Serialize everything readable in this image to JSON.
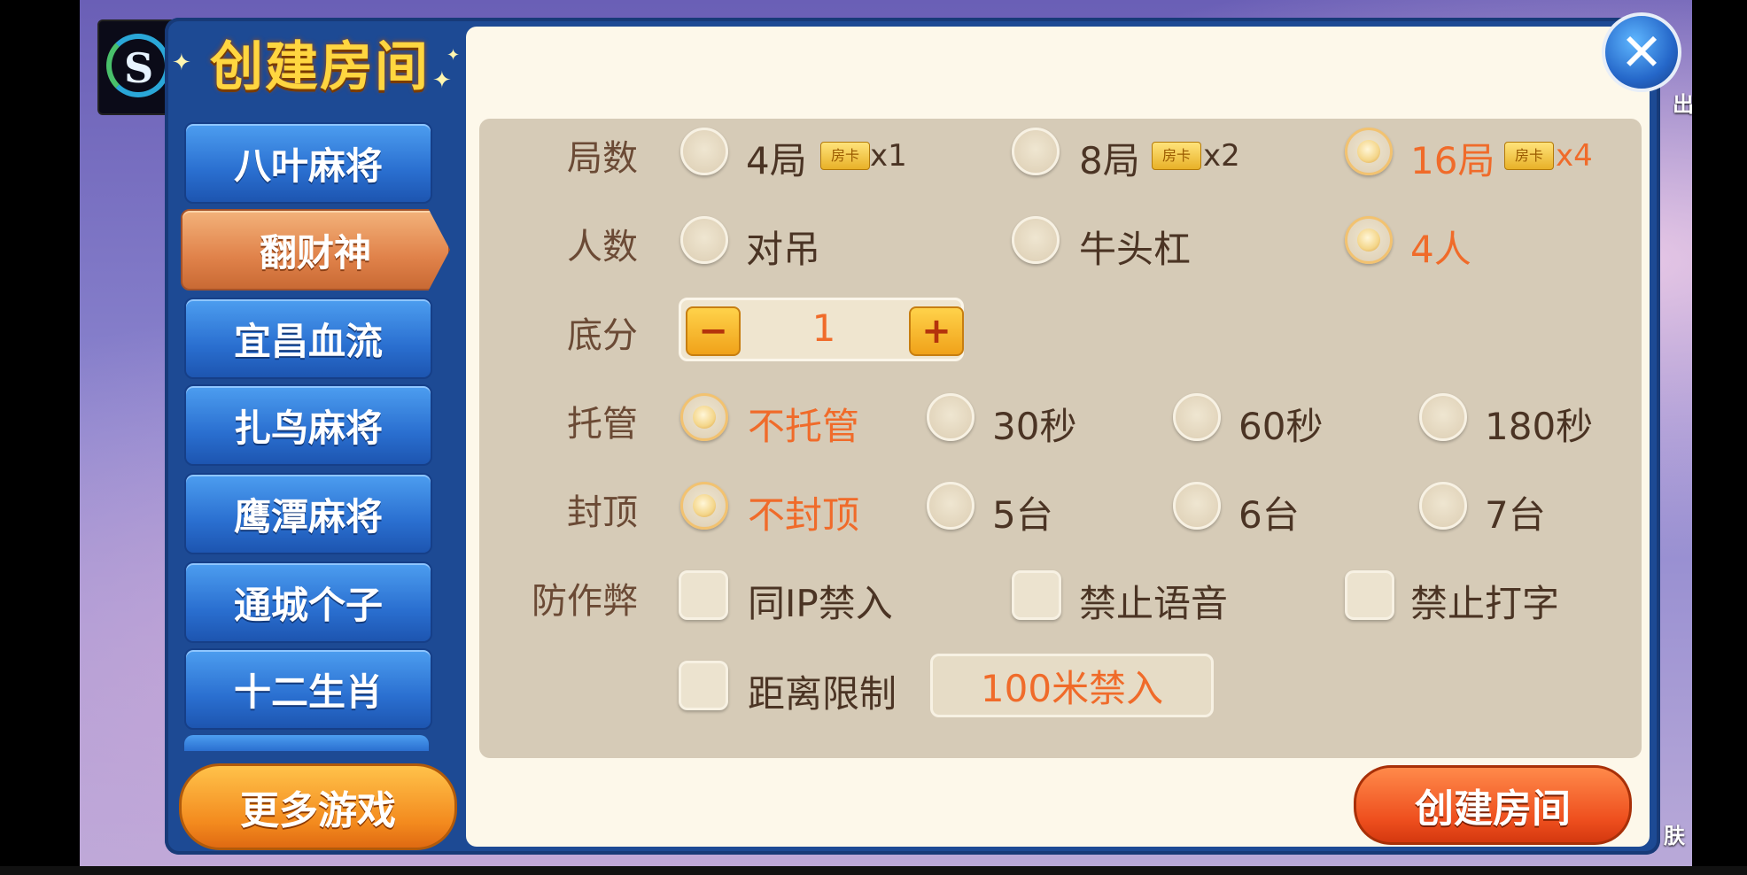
{
  "app": {
    "title": "创建房间",
    "logo_letter": "S",
    "side_labels": {
      "exit": "出",
      "skin": "肤"
    }
  },
  "sidebar": {
    "tabs": [
      {
        "label": "八叶麻将"
      },
      {
        "label": "翻财神"
      },
      {
        "label": "宜昌血流"
      },
      {
        "label": "扎鸟麻将"
      },
      {
        "label": "鹰潭麻将"
      },
      {
        "label": "通城个子"
      },
      {
        "label": "十二生肖"
      }
    ],
    "active_index": 1,
    "more_games_label": "更多游戏"
  },
  "options": {
    "rounds": {
      "label": "局数",
      "choices": [
        {
          "text": "4局",
          "card": "房卡",
          "mult": "x1"
        },
        {
          "text": "8局",
          "card": "房卡",
          "mult": "x2"
        },
        {
          "text": "16局",
          "card": "房卡",
          "mult": "x4"
        }
      ],
      "selected": 2
    },
    "players": {
      "label": "人数",
      "choices": [
        {
          "text": "对吊"
        },
        {
          "text": "牛头杠"
        },
        {
          "text": "4人"
        }
      ],
      "selected": 2
    },
    "base_score": {
      "label": "底分",
      "value": "1",
      "minus": "−",
      "plus": "+"
    },
    "auto_play": {
      "label": "托管",
      "choices": [
        {
          "text": "不托管"
        },
        {
          "text": "30秒"
        },
        {
          "text": "60秒"
        },
        {
          "text": "180秒"
        }
      ],
      "selected": 0
    },
    "cap": {
      "label": "封顶",
      "choices": [
        {
          "text": "不封顶"
        },
        {
          "text": "5台"
        },
        {
          "text": "6台"
        },
        {
          "text": "7台"
        }
      ],
      "selected": 0
    },
    "anti_cheat": {
      "label": "防作弊",
      "choices": [
        {
          "text": "同IP禁入"
        },
        {
          "text": "禁止语音"
        },
        {
          "text": "禁止打字"
        },
        {
          "text": "距离限制"
        }
      ],
      "distance_value": "100米禁入"
    }
  },
  "actions": {
    "create_label": "创建房间",
    "close_icon": "close-icon"
  },
  "colors": {
    "selected_text": "#f06b2a",
    "panel_blue": "#1d4a94",
    "tab_active": "#e0824a"
  }
}
